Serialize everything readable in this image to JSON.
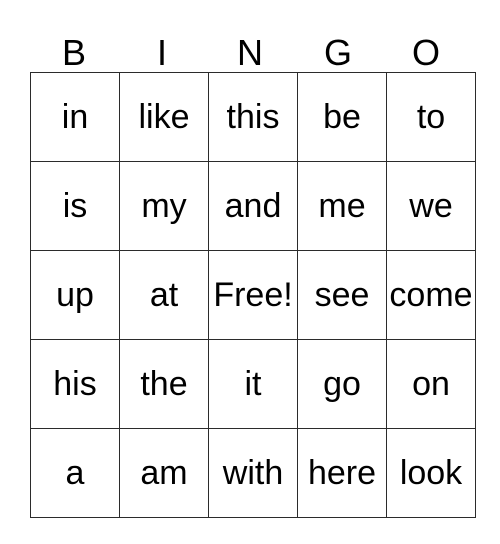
{
  "card": {
    "title": "BINGO",
    "header_letters": [
      "B",
      "I",
      "N",
      "G",
      "O"
    ],
    "grid_rows": [
      [
        "in",
        "like",
        "this",
        "be",
        "to"
      ],
      [
        "is",
        "my",
        "and",
        "me",
        "we"
      ],
      [
        "up",
        "at",
        "Free!",
        "see",
        "come"
      ],
      [
        "his",
        "the",
        "it",
        "go",
        "on"
      ],
      [
        "a",
        "am",
        "with",
        "here",
        "look"
      ]
    ],
    "free_space": {
      "label": "Free!",
      "row": 2,
      "column": 2
    },
    "colors": {
      "background": "#ffffff",
      "text": "#000000",
      "border": "#2b2b2b"
    }
  }
}
